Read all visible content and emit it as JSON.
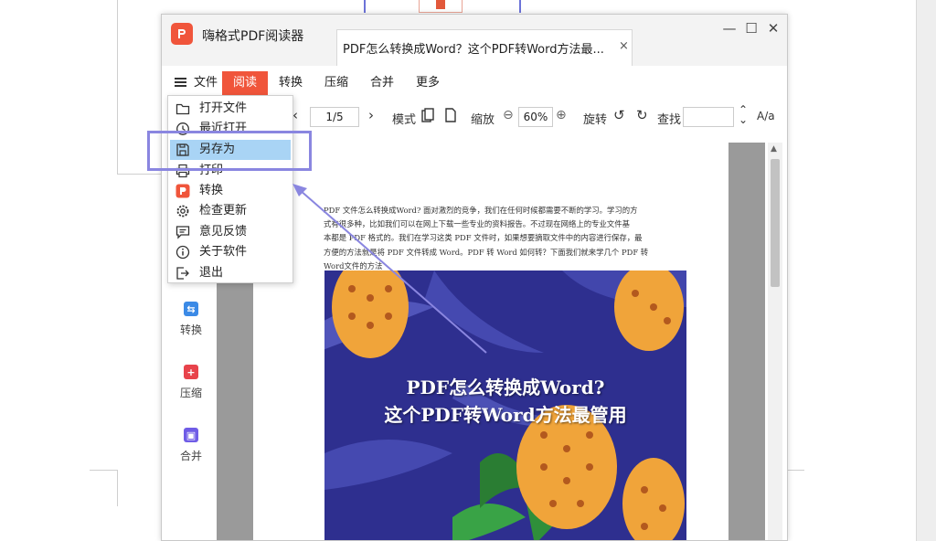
{
  "app": {
    "title": "嗨格式PDF阅读器",
    "accent": "#f0553b"
  },
  "tab": {
    "label": "PDF怎么转换成Word？这个PDF转Word方法最...",
    "close": "×"
  },
  "window_controls": {
    "minimize": "—",
    "maximize": "☐",
    "close": "✕"
  },
  "menu": {
    "items": [
      "文件",
      "阅读",
      "转换",
      "压缩",
      "合并",
      "更多"
    ],
    "active": "阅读"
  },
  "toolbar": {
    "page": "1/5",
    "mode_label": "模式",
    "zoom_label": "缩放",
    "zoom_value": "60%",
    "rotate_label": "旋转",
    "find_label": "查找",
    "find_placeholder": "",
    "case_toggle": "A/a"
  },
  "dropdown": {
    "items": [
      {
        "label": "打开文件",
        "icon": "folder-icon"
      },
      {
        "label": "最近打开",
        "icon": "clock-icon"
      },
      {
        "label": "另存为",
        "icon": "save-icon"
      },
      {
        "label": "打印",
        "icon": "printer-icon"
      },
      {
        "label": "转换",
        "icon": "convert-app-icon"
      },
      {
        "label": "检查更新",
        "icon": "gear-icon"
      },
      {
        "label": "意见反馈",
        "icon": "feedback-icon"
      },
      {
        "label": "关于软件",
        "icon": "info-icon"
      },
      {
        "label": "退出",
        "icon": "exit-icon"
      }
    ],
    "highlighted": "另存为"
  },
  "sidebar": {
    "items": [
      {
        "label": "转换",
        "icon": "convert-icon",
        "color": "#3b8ae6"
      },
      {
        "label": "压缩",
        "icon": "compress-icon",
        "color": "#e8434b"
      },
      {
        "label": "合并",
        "icon": "merge-icon",
        "color": "#6f5ce6"
      }
    ]
  },
  "document": {
    "paragraph": [
      "PDF 文件怎么转换成Word? 面对激烈的竞争，我们在任何时候都需要不断的学习。学习的方",
      "式有很多种，比如我们可以在网上下载一些专业的资料报告。不过现在网络上的专业文件基",
      "本都是 PDF 格式的。我们在学习这类 PDF 文件时，如果想要摘取文件中的内容进行保存，最",
      "方便的方法就是将 PDF 文件转成 Word。PDF 转 Word 如何转？下面我们就来学几个 PDF 转",
      "Word文件的方法"
    ],
    "cover_line1": "PDF怎么转换成Word?",
    "cover_line2": "这个PDF转Word方法最管用"
  }
}
